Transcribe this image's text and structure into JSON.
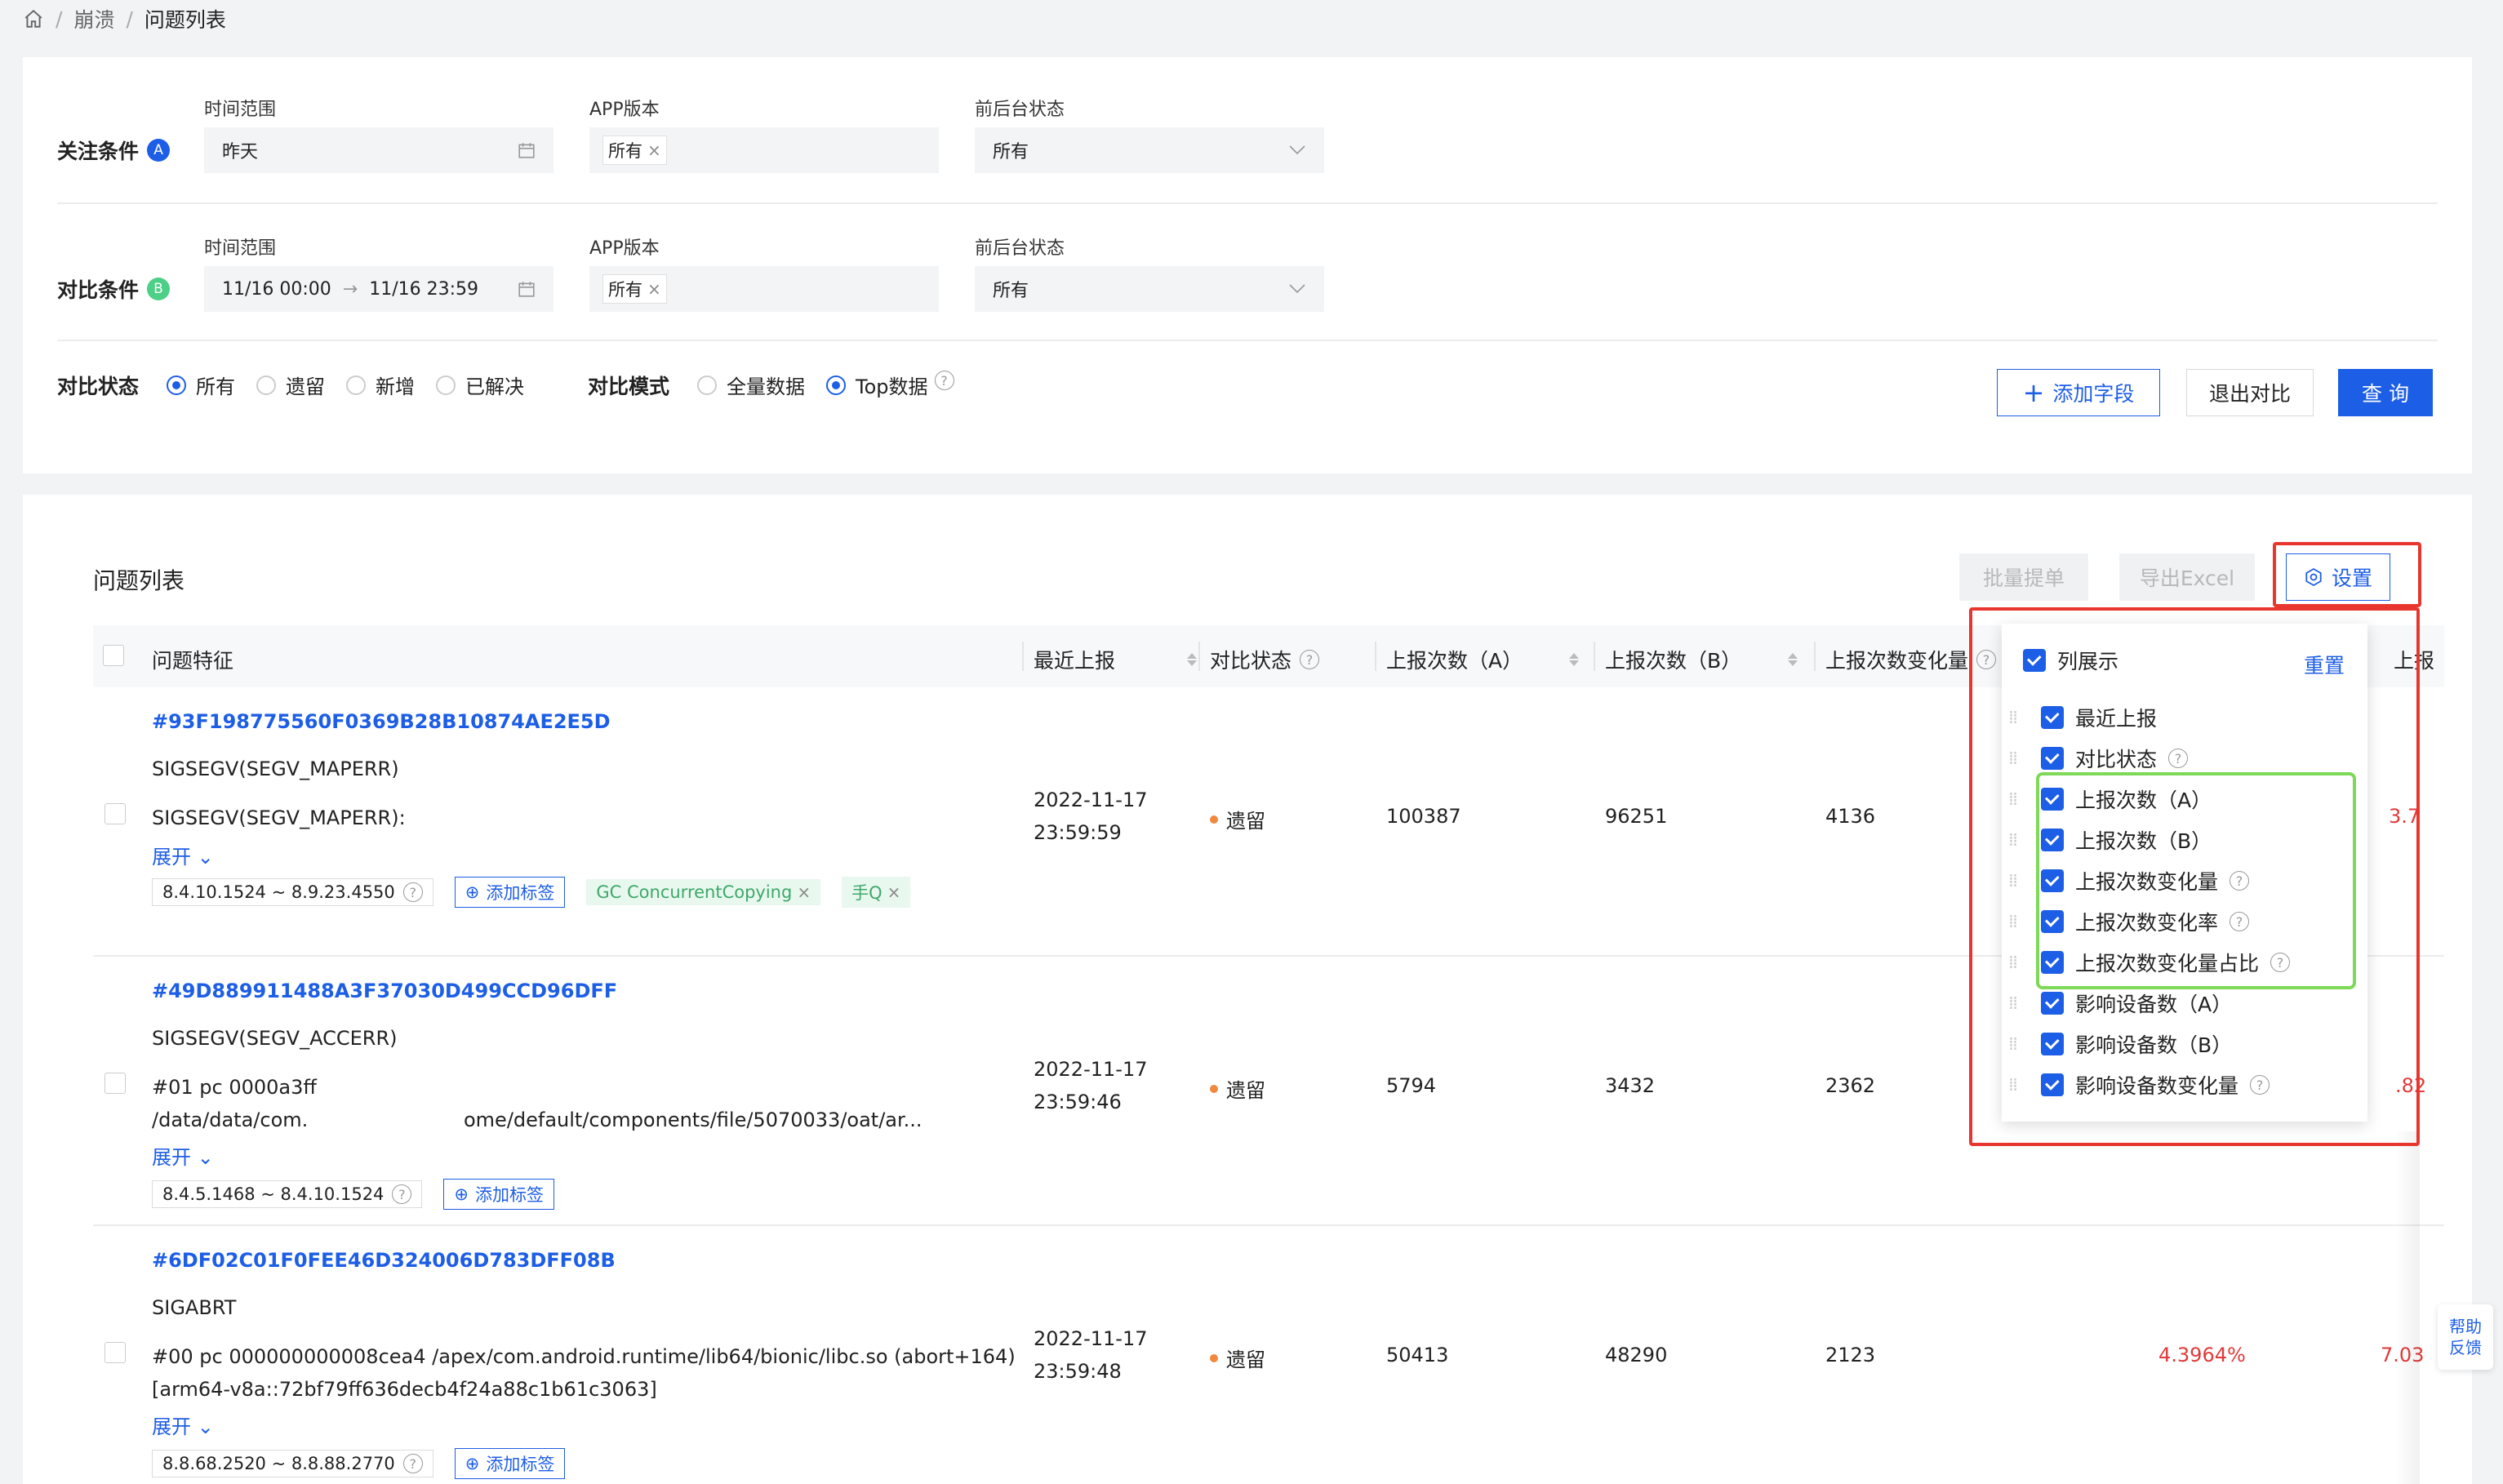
{
  "breadcrumb": {
    "items": [
      "崩溃",
      "问题列表"
    ]
  },
  "filters": {
    "focus": {
      "title": "关注条件",
      "badge": "A",
      "time_label": "时间范围",
      "time_value": "昨天",
      "version_label": "APP版本",
      "version_value": "所有",
      "state_label": "前后台状态",
      "state_value": "所有"
    },
    "compare": {
      "title": "对比条件",
      "badge": "B",
      "time_label": "时间范围",
      "time_start": "11/16 00:00",
      "time_end": "11/16 23:59",
      "version_label": "APP版本",
      "version_value": "所有",
      "state_label": "前后台状态",
      "state_value": "所有"
    },
    "compare_status": {
      "label": "对比状态",
      "options": [
        "所有",
        "遗留",
        "新增",
        "已解决"
      ],
      "selected": "所有"
    },
    "compare_mode": {
      "label": "对比模式",
      "options": [
        "全量数据",
        "Top数据"
      ],
      "selected": "Top数据"
    },
    "buttons": {
      "add_field": "添加字段",
      "exit_compare": "退出对比",
      "query": "查 询"
    }
  },
  "list": {
    "title": "问题列表",
    "buttons": {
      "batch": "批量提单",
      "export": "导出Excel",
      "settings": "设置"
    },
    "columns": [
      "问题特征",
      "最近上报",
      "对比状态",
      "上报次数（A）",
      "上报次数（B）",
      "上报次数变化量",
      "上报"
    ],
    "rows": [
      {
        "id": "#93F198775560F0369B28B10874AE2E5D",
        "signal": "SIGSEGV(SEGV_MAPERR)",
        "detail1": "SIGSEGV(SEGV_MAPERR):",
        "detail2": "",
        "expand": "展开",
        "version": "8.4.10.1524 ~ 8.9.23.4550",
        "add_tag": "添加标签",
        "tags": [
          "GC ConcurrentCopying",
          "手Q"
        ],
        "date": "2022-11-17",
        "time": "23:59:59",
        "status": "遗留",
        "count_a": "100387",
        "count_b": "96251",
        "delta": "4136",
        "rate": "",
        "tail": "3.7"
      },
      {
        "id": "#49D889911488A3F37030D499CCD96DFF",
        "signal": "SIGSEGV(SEGV_ACCERR)",
        "detail1": "#01 pc 0000a3ff",
        "detail2": "/data/data/com.                         ome/default/components/file/5070033/oat/ar...",
        "expand": "展开",
        "version": "8.4.5.1468 ~ 8.4.10.1524",
        "add_tag": "添加标签",
        "tags": [],
        "date": "2022-11-17",
        "time": "23:59:46",
        "status": "遗留",
        "count_a": "5794",
        "count_b": "3432",
        "delta": "2362",
        "rate": "",
        "tail": ".82"
      },
      {
        "id": "#6DF02C01F0FEE46D324006D783DFF08B",
        "signal": "SIGABRT",
        "detail1": "#00 pc 000000000008cea4 /apex/com.android.runtime/lib64/bionic/libc.so (abort+164)",
        "detail2": "[arm64-v8a::72bf79ff636decb4f24a88c1b61c3063]",
        "expand": "展开",
        "version": "8.8.68.2520 ~ 8.8.88.2770",
        "add_tag": "添加标签",
        "tags": [],
        "date": "2022-11-17",
        "time": "23:59:48",
        "status": "遗留",
        "count_a": "50413",
        "count_b": "48290",
        "delta": "2123",
        "rate": "4.3964%",
        "tail": "7.03"
      }
    ]
  },
  "column_settings": {
    "title": "列展示",
    "reset": "重置",
    "items": [
      {
        "label": "最近上报",
        "help": false
      },
      {
        "label": "对比状态",
        "help": true
      },
      {
        "label": "上报次数（A）",
        "help": false
      },
      {
        "label": "上报次数（B）",
        "help": false
      },
      {
        "label": "上报次数变化量",
        "help": true
      },
      {
        "label": "上报次数变化率",
        "help": true
      },
      {
        "label": "上报次数变化量占比",
        "help": true
      },
      {
        "label": "影响设备数（A）",
        "help": false
      },
      {
        "label": "影响设备数（B）",
        "help": false
      },
      {
        "label": "影响设备数变化量",
        "help": true
      }
    ]
  },
  "help_widget": {
    "line1": "帮助",
    "line2": "反馈"
  },
  "colors": {
    "primary": "#1d5ee6",
    "highlight_red": "#e8362f",
    "highlight_green": "#7ed957",
    "status_dot": "#f0883e",
    "badge_a": "#1d5ee6",
    "badge_b": "#4ccf86"
  }
}
